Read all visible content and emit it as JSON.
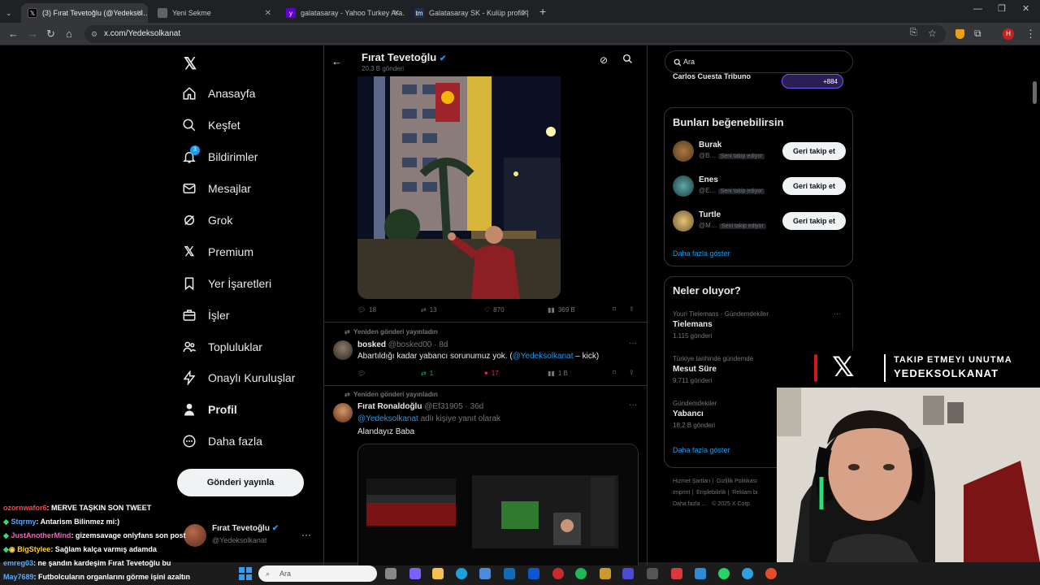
{
  "browser": {
    "tabs": [
      {
        "title": "(3) Fırat Tevetoğlu (@Yedeksol…",
        "active": true,
        "favicon": "x-logo"
      },
      {
        "title": "Yeni Sekme",
        "active": false,
        "favicon": "none"
      },
      {
        "title": "galatasaray - Yahoo Turkey Ara…",
        "active": false,
        "favicon": "yahoo"
      },
      {
        "title": "Galatasaray SK - Kulüp profili |",
        "active": false,
        "favicon": "tm"
      }
    ],
    "url": "x.com/Yedeksolkanat"
  },
  "sidebar": {
    "items": [
      {
        "label": "Anasayfa",
        "icon": "home-icon"
      },
      {
        "label": "Keşfet",
        "icon": "search-icon"
      },
      {
        "label": "Bildirimler",
        "icon": "bell-icon",
        "badge": "3"
      },
      {
        "label": "Mesajlar",
        "icon": "mail-icon"
      },
      {
        "label": "Grok",
        "icon": "grok-icon"
      },
      {
        "label": "Premium",
        "icon": "x-icon"
      },
      {
        "label": "Yer İşaretleri",
        "icon": "bookmark-icon"
      },
      {
        "label": "İşler",
        "icon": "briefcase-icon"
      },
      {
        "label": "Topluluklar",
        "icon": "people-icon"
      },
      {
        "label": "Onaylı Kuruluşlar",
        "icon": "lightning-icon"
      },
      {
        "label": "Profil",
        "icon": "person-icon"
      },
      {
        "label": "Daha fazla",
        "icon": "more-icon"
      }
    ],
    "post_button": "Gönderi yayınla",
    "account": {
      "name": "Fırat Tevetoğlu",
      "handle": "@Yedeksolkanat"
    }
  },
  "profile_header": {
    "name": "Fırat Tevetoğlu",
    "posts": "20,3 B gönderi"
  },
  "tweets": [
    {
      "actions": {
        "replies": "18",
        "reposts": "13",
        "likes": "870",
        "views": "369 B"
      }
    },
    {
      "repost_label": "Yeniden gönderi yayınladın",
      "name": "bosked",
      "handle": "@bosked00",
      "time": "8d",
      "text_before": "Abartıldığı kadar yabancı sorunumuz yok. (",
      "mention": "@Yedeksolkanat",
      "text_after": " – kick)",
      "actions": {
        "replies": "",
        "reposts": "1",
        "likes": "17",
        "views": "1 B"
      }
    },
    {
      "repost_label": "Yeniden gönderi yayınladın",
      "name": "Fırat Ronaldoğlu",
      "handle": "@Ef31905",
      "time": "36d",
      "reply_to_mention": "@Yedeksolkanat",
      "reply_to_suffix": " adlı kişiye yanıt olarak",
      "text": "Alandayız Baba"
    }
  ],
  "search": {
    "placeholder": "Ara"
  },
  "top_strip": {
    "name": "Carlos Cuesta Tribuno",
    "count": "+884"
  },
  "who_to_follow": {
    "title": "Bunları beğenebilirsin",
    "users": [
      {
        "name": "Burak",
        "handle": "@B…",
        "badge": "Seni takip ediyor",
        "button": "Geri takip et"
      },
      {
        "name": "Enes",
        "handle": "@E…",
        "badge": "Seni takip ediyor",
        "button": "Geri takip et"
      },
      {
        "name": "Turtle",
        "handle": "@M…",
        "badge": "Seni takip ediyor",
        "button": "Geri takip et"
      }
    ],
    "show_more": "Daha fazla göster"
  },
  "trends": {
    "title": "Neler oluyor?",
    "items": [
      {
        "context": "Youri Tielemans · Gündemdekiler",
        "name": "Tielemans",
        "count": "1.115 gönderi"
      },
      {
        "context": "Türkiye tarihinde gündemde",
        "name": "Mesut Süre",
        "count": "9.711 gönderi"
      },
      {
        "context": "Gündemdekiler",
        "name": "Yabancı",
        "count": "18,2 B gönderi"
      }
    ],
    "show_more": "Daha fazla göster"
  },
  "footer": {
    "links": [
      "Hizmet Şartları",
      "Gizlilik Politikası",
      "Imprint",
      "Erişilebilirlik",
      "Reklam bi",
      "Daha fazla …",
      "© 2025 X Corp."
    ]
  },
  "overlay": {
    "line1": "TAKIP ETMEYI UNUTMA",
    "line2": "YEDEKSOLKANAT"
  },
  "chat": [
    {
      "user": "ozornwafor6",
      "msg": ": MERVE TAŞKIN SON TWEET",
      "color": "#ff4444"
    },
    {
      "user": "Stqrmy",
      "msg": ": Antarism Bilinmez mi:)",
      "color": "#5aa9ff"
    },
    {
      "user": "JustAnotherMind",
      "msg": ": gizemsavage onlyfans son post",
      "color": "#ff5ac8"
    },
    {
      "user": "BigStylee",
      "msg": ": Sağlam kalça varmış adamda",
      "color": "#ffd23c"
    },
    {
      "user": "emreg03",
      "msg": ": ne şandın kardeşim Fırat Tevetoğlu bu",
      "color": "#5aa9ff"
    },
    {
      "user": "May7689",
      "msg": ": Futbolcuların organlarını görme işini azaltın",
      "color": "#5aa9ff"
    }
  ],
  "taskbar": {
    "search": "Ara"
  },
  "colors": {
    "accent": "#1d9bf0",
    "like": "#f91880",
    "repost": "#00ba7c"
  }
}
